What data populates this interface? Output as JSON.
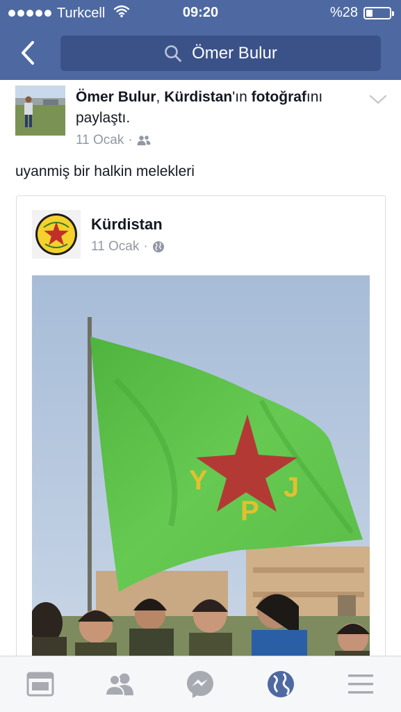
{
  "status_bar": {
    "carrier": "Turkcell",
    "time": "09:20",
    "battery_text": "%28",
    "battery_level": 0.28,
    "icons": [
      "signal-dots-icon",
      "wifi-icon",
      "battery-icon"
    ]
  },
  "nav": {
    "back_icon": "chevron-left-icon",
    "search_icon": "search-icon",
    "search_text": "Ömer Bulur"
  },
  "post": {
    "author_name": "Ömer Bulur",
    "separator": ", ",
    "shared_page": "Kürdistan",
    "shared_page_suffix": "'ın",
    "object": "fotoğraf",
    "object_suffix": "ını paylaştı.",
    "date": "11 Ocak",
    "dot": "·",
    "audience_icon": "friends-icon",
    "menu_icon": "chevron-down-icon",
    "caption": "uyanmiş bir halkin melekleri"
  },
  "shared": {
    "page_name": "Kürdistan",
    "date": "11 Ocak",
    "dot": "·",
    "audience_icon": "globe-icon",
    "flag_letters": [
      "Y",
      "P",
      "J"
    ],
    "colors": {
      "flag": "#5fc44a",
      "star": "#b33a34",
      "letters": "#e2c02f",
      "logo_ring": "#1c1c1c",
      "logo_fill": "#f4d12c"
    }
  },
  "tabbar": {
    "tabs": [
      {
        "name": "news-feed",
        "icon": "news-feed-icon",
        "active": false
      },
      {
        "name": "friend-requests",
        "icon": "friends-icon",
        "active": false
      },
      {
        "name": "messenger",
        "icon": "messenger-icon",
        "active": false
      },
      {
        "name": "notifications",
        "icon": "globe-icon",
        "active": true
      },
      {
        "name": "more",
        "icon": "menu-icon",
        "active": false
      }
    ],
    "colors": {
      "inactive": "#a7abb1",
      "active": "#4e69a2"
    }
  }
}
